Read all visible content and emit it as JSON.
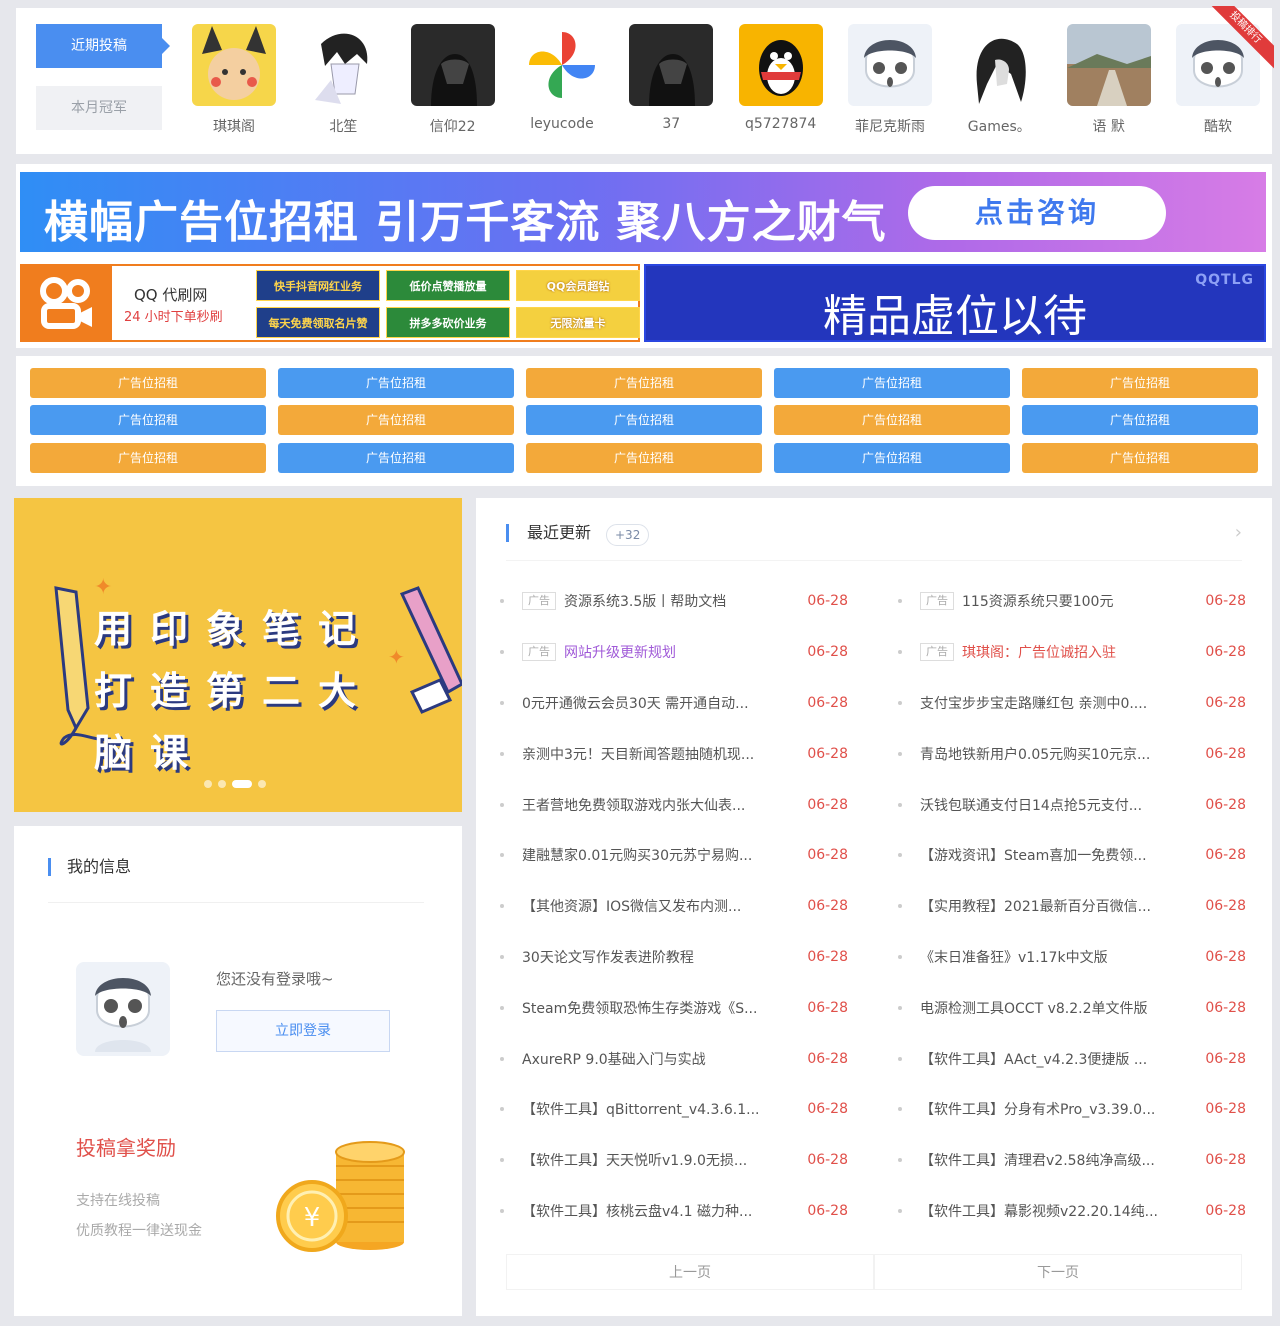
{
  "top": {
    "tab_active": "近期投稿",
    "tab_inactive": "本月冠军",
    "ribbon": "投稿排行",
    "users": [
      {
        "name": "琪琪阁",
        "avatar": "pikachu-avatar"
      },
      {
        "name": "北笙",
        "avatar": "anime-boy-avatar"
      },
      {
        "name": "信仰22",
        "avatar": "dark-avatar"
      },
      {
        "name": "leyucode",
        "avatar": "pinwheel-avatar"
      },
      {
        "name": "37",
        "avatar": "dark-avatar"
      },
      {
        "name": "q5727874",
        "avatar": "qq-penguin-avatar"
      },
      {
        "name": "菲尼克斯雨",
        "avatar": "default-avatar"
      },
      {
        "name": "Games。",
        "avatar": "sketch-avatar"
      },
      {
        "name": "语 默",
        "avatar": "landscape-avatar"
      },
      {
        "name": "酷软",
        "avatar": "default-avatar"
      }
    ]
  },
  "banners": {
    "banner1_text": "横幅广告位招租 引万千客流 聚八方之财气",
    "banner1_button": "点击咨询",
    "banner2_title": "QQ 代刷网",
    "banner2_sub": "24 小时下单秒刷",
    "banner2_tags": [
      "快手抖音网红业务",
      "低价点赞播放量",
      "QQ会员超钻",
      "每天免费领取名片赞",
      "拼多多砍价业务",
      "无限流量卡"
    ],
    "banner3_text": "精品虚位以待",
    "banner3_corner": "QQTLG"
  },
  "ads": [
    "广告位招租",
    "广告位招租",
    "广告位招租",
    "广告位招租",
    "广告位招租",
    "广告位招租",
    "广告位招租",
    "广告位招租",
    "广告位招租",
    "广告位招租",
    "广告位招租",
    "广告位招租",
    "广告位招租",
    "广告位招租",
    "广告位招租"
  ],
  "slider": {
    "text": "用印象笔记打造第二大脑课"
  },
  "myinfo": {
    "title": "我的信息",
    "login_tip": "您还没有登录哦~",
    "login_button": "立即登录",
    "reward_title": "投稿拿奖励",
    "reward_line1": "支持在线投稿",
    "reward_line2": "优质教程一律送现金"
  },
  "news": {
    "title": "最近更新",
    "count": "+32",
    "more": "›",
    "items": [
      {
        "tag": "广告",
        "title": "资源系统3.5版丨帮助文档",
        "date": "06-28",
        "style": ""
      },
      {
        "tag": "广告",
        "title": "115资源系统只要100元",
        "date": "06-28",
        "style": ""
      },
      {
        "tag": "广告",
        "title": "网站升级更新规划",
        "date": "06-28",
        "style": "purple"
      },
      {
        "tag": "广告",
        "title": "琪琪阁：广告位诚招入驻",
        "date": "06-28",
        "style": "red"
      },
      {
        "tag": "",
        "title": "0元开通微云会员30天 需开通自动...",
        "date": "06-28",
        "style": ""
      },
      {
        "tag": "",
        "title": "支付宝步步宝走路赚红包 亲测中0....",
        "date": "06-28",
        "style": ""
      },
      {
        "tag": "",
        "title": "亲测中3元！天目新闻答题抽随机现...",
        "date": "06-28",
        "style": ""
      },
      {
        "tag": "",
        "title": "青岛地铁新用户0.05元购买10元京...",
        "date": "06-28",
        "style": ""
      },
      {
        "tag": "",
        "title": "王者营地免费领取游戏内张大仙表...",
        "date": "06-28",
        "style": ""
      },
      {
        "tag": "",
        "title": "沃钱包联通支付日14点抢5元支付...",
        "date": "06-28",
        "style": ""
      },
      {
        "tag": "",
        "title": "建融慧家0.01元购买30元苏宁易购...",
        "date": "06-28",
        "style": ""
      },
      {
        "tag": "",
        "title": "【游戏资讯】Steam喜加一免费领...",
        "date": "06-28",
        "style": ""
      },
      {
        "tag": "",
        "title": "【其他资源】IOS微信又发布内测...",
        "date": "06-28",
        "style": ""
      },
      {
        "tag": "",
        "title": "【实用教程】2021最新百分百微信...",
        "date": "06-28",
        "style": ""
      },
      {
        "tag": "",
        "title": "30天论文写作发表进阶教程",
        "date": "06-28",
        "style": ""
      },
      {
        "tag": "",
        "title": "《末日准备狂》v1.17k中文版",
        "date": "06-28",
        "style": ""
      },
      {
        "tag": "",
        "title": "Steam免费领取恐怖生存类游戏《S...",
        "date": "06-28",
        "style": ""
      },
      {
        "tag": "",
        "title": "电源检测工具OCCT v8.2.2单文件版",
        "date": "06-28",
        "style": ""
      },
      {
        "tag": "",
        "title": "AxureRP 9.0基础入门与实战",
        "date": "06-28",
        "style": ""
      },
      {
        "tag": "",
        "title": "【软件工具】AAct_v4.2.3便捷版 ...",
        "date": "06-28",
        "style": ""
      },
      {
        "tag": "",
        "title": "【软件工具】qBittorrent_v4.3.6.1...",
        "date": "06-28",
        "style": ""
      },
      {
        "tag": "",
        "title": "【软件工具】分身有术Pro_v3.39.0...",
        "date": "06-28",
        "style": ""
      },
      {
        "tag": "",
        "title": "【软件工具】天天悦听v1.9.0无损...",
        "date": "06-28",
        "style": ""
      },
      {
        "tag": "",
        "title": "【软件工具】清理君v2.58纯净高级...",
        "date": "06-28",
        "style": ""
      },
      {
        "tag": "",
        "title": "【软件工具】核桃云盘v4.1 磁力种...",
        "date": "06-28",
        "style": ""
      },
      {
        "tag": "",
        "title": "【软件工具】幕影视频v22.20.14纯...",
        "date": "06-28",
        "style": ""
      }
    ],
    "prev": "上一页",
    "next": "下一页"
  }
}
